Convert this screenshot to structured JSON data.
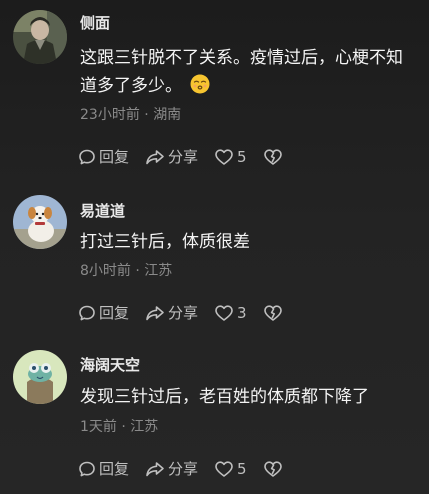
{
  "comments": [
    {
      "username": "侧面",
      "text": "这跟三针脱不了关系。疫情过后，心梗不知道多了多少。",
      "time": "23小时前",
      "location": "湖南",
      "reply_label": "回复",
      "share_label": "分享",
      "likes": "5"
    },
    {
      "username": "易道道",
      "text": "打过三针后，体质很差",
      "time": "8小时前",
      "location": "江苏",
      "reply_label": "回复",
      "share_label": "分享",
      "likes": "3"
    },
    {
      "username": "海阔天空",
      "text": "发现三针过后，老百姓的体质都下降了",
      "time": "1天前",
      "location": "江苏",
      "reply_label": "回复",
      "share_label": "分享",
      "likes": "5"
    }
  ],
  "meta_separator": "·",
  "icons": {
    "reply": "reply-bubble-icon",
    "share": "share-arrow-icon",
    "like": "heart-outline-icon",
    "dislike": "broken-heart-icon",
    "emoji": "kissing-face-emoji"
  },
  "colors": {
    "text_primary": "#f4f4f4",
    "text_secondary": "#8a8a8a",
    "action_gray": "#bfbfbf",
    "emoji_yellow": "#f7c530"
  }
}
